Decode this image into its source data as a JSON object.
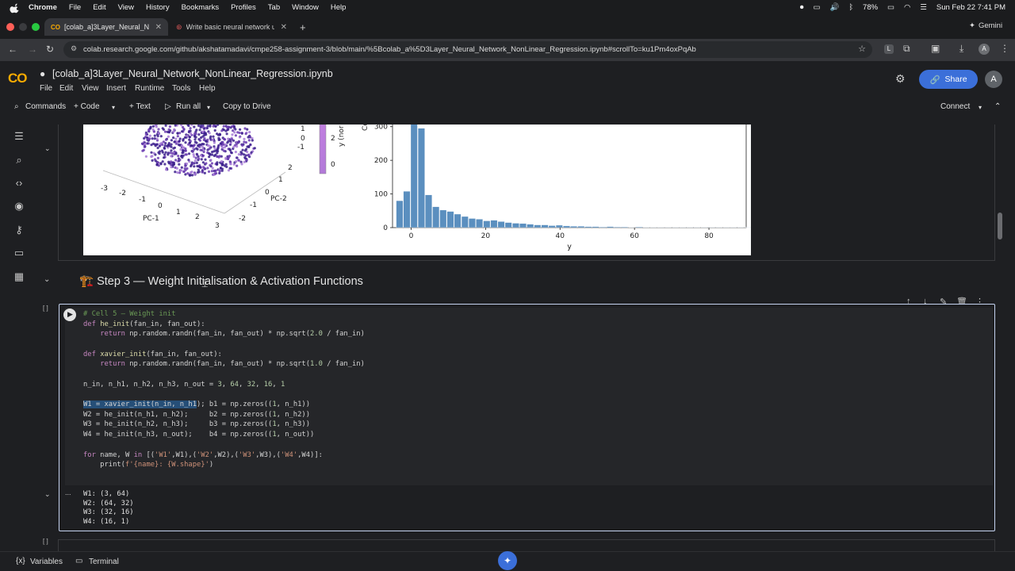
{
  "menubar": {
    "app": "Chrome",
    "items": [
      "File",
      "Edit",
      "View",
      "History",
      "Bookmarks",
      "Profiles",
      "Tab",
      "Window",
      "Help"
    ],
    "battery": "78%",
    "datetime": "Sun Feb 22  7:41 PM"
  },
  "tabs": [
    {
      "title": "[colab_a]3Layer_Neural_Net"
    },
    {
      "title": "Write basic neural network u"
    }
  ],
  "gemini_label": "Gemini",
  "url": "colab.research.google.com/github/akshatamadavi/cmpe258-assignment-3/blob/main/%5Bcolab_a%5D3Layer_Neural_Network_NonLinear_Regression.ipynb#scrollTo=ku1Pm4oxPqAb",
  "colab": {
    "title": "[colab_a]3Layer_Neural_Network_NonLinear_Regression.ipynb",
    "menu": [
      "File",
      "Edit",
      "View",
      "Insert",
      "Runtime",
      "Tools",
      "Help"
    ],
    "share": "Share",
    "avatar": "A",
    "toolbar": {
      "commands": "Commands",
      "code": "+ Code",
      "text": "+ Text",
      "run_all": "Run all",
      "copy": "Copy to Drive",
      "connect": "Connect"
    }
  },
  "plot3d": {
    "xlabel": "PC-1",
    "ylabel": "PC-2",
    "xticks": [
      "-3",
      "-2",
      "-1",
      "0",
      "1",
      "2",
      "3"
    ],
    "yticks": [
      "-2",
      "-1",
      "0",
      "1",
      "2"
    ],
    "zticks": [
      "1",
      "0",
      "-1"
    ],
    "colorbar_label": "y (nor",
    "colorbar_ticks": [
      "2",
      "0"
    ]
  },
  "chart_data": {
    "type": "bar",
    "xlabel": "y",
    "ylabel": "Co",
    "xlim": [
      -5,
      90
    ],
    "ylim": [
      0,
      330
    ],
    "xticks": [
      0,
      20,
      40,
      60,
      80
    ],
    "yticks": [
      0,
      100,
      200,
      300
    ],
    "bin_start": -4,
    "bin_width": 1.95,
    "values": [
      80,
      108,
      335,
      295,
      97,
      62,
      52,
      48,
      40,
      33,
      27,
      25,
      20,
      22,
      18,
      15,
      13,
      12,
      10,
      8,
      8,
      6,
      7,
      5,
      4,
      4,
      3,
      3,
      2,
      3,
      2,
      2,
      1,
      2,
      1,
      1,
      1,
      1,
      1,
      1,
      1,
      1,
      1,
      1,
      1,
      1,
      1,
      1,
      1,
      1,
      1
    ],
    "color": "#5b8fbf"
  },
  "section": {
    "title": "🏗️ Step 3 — Weight Initialisation & Activation Functions"
  },
  "cell": {
    "bracket": "[ ]",
    "output_toggle": "..."
  },
  "output": [
    "W1: (3, 64)",
    "W2: (64, 32)",
    "W3: (32, 16)",
    "W4: (16, 1)"
  ],
  "statusbar": {
    "variables": "Variables",
    "terminal": "Terminal"
  }
}
